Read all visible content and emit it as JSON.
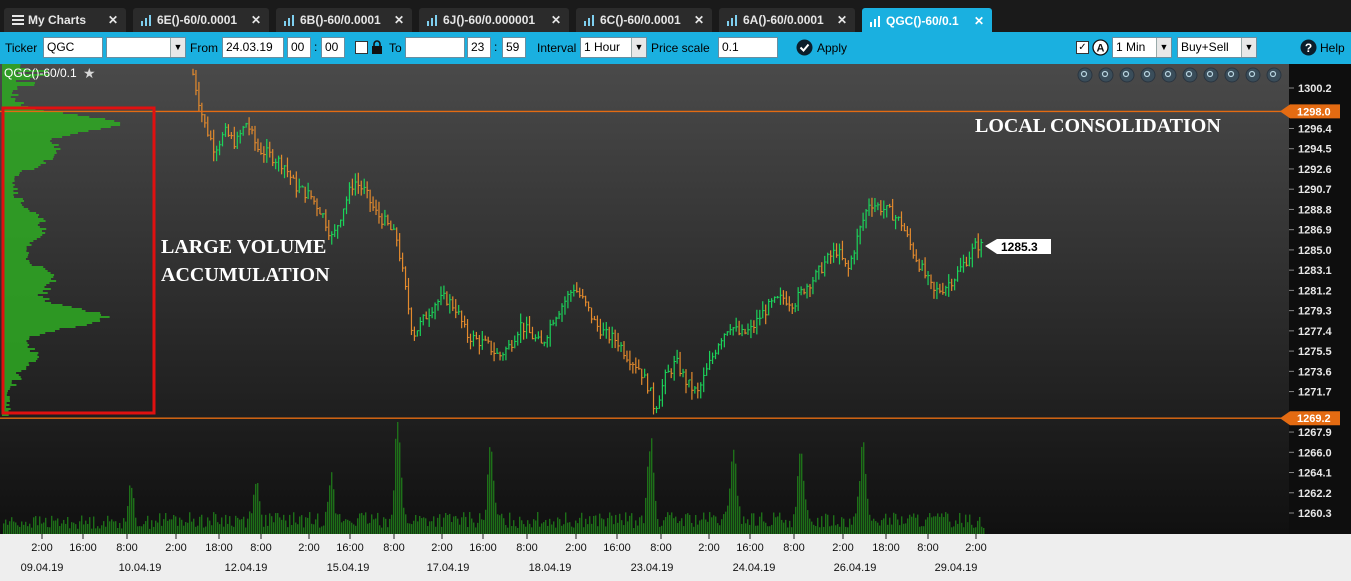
{
  "tabs": [
    {
      "label": "My Charts",
      "icon": "menu-icon",
      "active": false
    },
    {
      "label": "6E()-60/0.0001",
      "icon": "chart-icon",
      "active": false
    },
    {
      "label": "6B()-60/0.0001",
      "icon": "chart-icon",
      "active": false
    },
    {
      "label": "6J()-60/0.000001",
      "icon": "chart-icon",
      "active": false
    },
    {
      "label": "6C()-60/0.0001",
      "icon": "chart-icon",
      "active": false
    },
    {
      "label": "6A()-60/0.0001",
      "icon": "chart-icon",
      "active": false
    },
    {
      "label": "QGC()-60/0.1",
      "icon": "chart-icon",
      "active": true
    }
  ],
  "toolbar": {
    "ticker_label": "Ticker",
    "ticker_value": "QGC",
    "from_label": "From",
    "from_date": "24.03.19",
    "from_hour": "00",
    "from_min": "00",
    "to_label": "To",
    "to_date": "",
    "to_hour": "23",
    "to_min": "59",
    "interval_label": "Interval",
    "interval_value": "1 Hour",
    "price_scale_label": "Price scale",
    "price_scale_value": "0.1",
    "apply_label": "Apply",
    "aggregation_value": "1 Min",
    "side_value": "Buy+Sell",
    "help_label": "Help"
  },
  "chart": {
    "title": "QGC()-60/0.1",
    "last_price": "1285.3",
    "annotation_local": "LOCAL CONSOLIDATION",
    "annotation_large_1": "LARGE VOLUME",
    "annotation_large_2": "ACCUMULATION",
    "colors": {
      "background_top": "#474747",
      "background_bottom": "#121212",
      "up_bar": "#1bd35a",
      "down_bar": "#e38a2d",
      "level_line": "#e46b12",
      "volume_profile": "#2eaa22",
      "box": "#e01010",
      "volume": "#1f7a1a"
    }
  },
  "chart_data": {
    "type": "bar",
    "subtype": "ohlc_with_volume_profile",
    "title": "QGC()-60/0.1",
    "y_ticks": [
      1300.2,
      1298.0,
      1296.4,
      1294.5,
      1292.6,
      1290.7,
      1288.8,
      1286.9,
      1285.0,
      1283.1,
      1281.2,
      1279.3,
      1277.4,
      1275.5,
      1273.6,
      1271.7,
      1269.2,
      1267.9,
      1266.0,
      1264.1,
      1262.2,
      1260.3
    ],
    "ylim": [
      1259.0,
      1302.0
    ],
    "level_lines": [
      1298.0,
      1269.2
    ],
    "last_price": 1285.3,
    "x_time_labels": [
      "2:00",
      "16:00",
      "8:00",
      "2:00",
      "18:00",
      "8:00",
      "2:00",
      "16:00",
      "8:00",
      "2:00",
      "16:00",
      "8:00",
      "2:00",
      "16:00",
      "8:00",
      "2:00",
      "16:00",
      "8:00",
      "2:00",
      "18:00",
      "8:00",
      "2:00"
    ],
    "x_date_labels": [
      "09.04.19",
      "10.04.19",
      "12.04.19",
      "15.04.19",
      "17.04.19",
      "18.04.19",
      "23.04.19",
      "24.04.19",
      "26.04.19",
      "29.04.19"
    ],
    "price_path": [
      {
        "t": 0,
        "p": 1301.5
      },
      {
        "t": 2,
        "p": 1297.0
      },
      {
        "t": 4,
        "p": 1294.5
      },
      {
        "t": 6,
        "p": 1296.0
      },
      {
        "t": 8,
        "p": 1295.0
      },
      {
        "t": 10,
        "p": 1297.0
      },
      {
        "t": 12,
        "p": 1294.5
      },
      {
        "t": 14,
        "p": 1294.0
      },
      {
        "t": 17,
        "p": 1293.0
      },
      {
        "t": 19,
        "p": 1291.0
      },
      {
        "t": 22,
        "p": 1290.0
      },
      {
        "t": 24,
        "p": 1288.5
      },
      {
        "t": 26,
        "p": 1286.0
      },
      {
        "t": 28,
        "p": 1289.0
      },
      {
        "t": 30,
        "p": 1291.5
      },
      {
        "t": 32,
        "p": 1290.5
      },
      {
        "t": 34,
        "p": 1288.5
      },
      {
        "t": 36,
        "p": 1287.5
      },
      {
        "t": 38,
        "p": 1286.0
      },
      {
        "t": 40,
        "p": 1280.0
      },
      {
        "t": 41,
        "p": 1277.0
      },
      {
        "t": 43,
        "p": 1278.5
      },
      {
        "t": 45,
        "p": 1280.0
      },
      {
        "t": 47,
        "p": 1280.5
      },
      {
        "t": 49,
        "p": 1279.5
      },
      {
        "t": 51,
        "p": 1277.0
      },
      {
        "t": 53,
        "p": 1276.5
      },
      {
        "t": 55,
        "p": 1276.0
      },
      {
        "t": 57,
        "p": 1275.0
      },
      {
        "t": 59,
        "p": 1276.0
      },
      {
        "t": 61,
        "p": 1278.0
      },
      {
        "t": 63,
        "p": 1277.0
      },
      {
        "t": 65,
        "p": 1276.0
      },
      {
        "t": 67,
        "p": 1278.5
      },
      {
        "t": 69,
        "p": 1280.0
      },
      {
        "t": 71,
        "p": 1281.5
      },
      {
        "t": 73,
        "p": 1280.0
      },
      {
        "t": 75,
        "p": 1278.0
      },
      {
        "t": 77,
        "p": 1277.0
      },
      {
        "t": 79,
        "p": 1276.5
      },
      {
        "t": 81,
        "p": 1275.0
      },
      {
        "t": 83,
        "p": 1274.0
      },
      {
        "t": 85,
        "p": 1272.0
      },
      {
        "t": 86,
        "p": 1270.0
      },
      {
        "t": 88,
        "p": 1273.0
      },
      {
        "t": 90,
        "p": 1274.5
      },
      {
        "t": 92,
        "p": 1272.5
      },
      {
        "t": 94,
        "p": 1271.5
      },
      {
        "t": 96,
        "p": 1274.0
      },
      {
        "t": 98,
        "p": 1276.5
      },
      {
        "t": 100,
        "p": 1278.0
      },
      {
        "t": 102,
        "p": 1277.0
      },
      {
        "t": 104,
        "p": 1277.5
      },
      {
        "t": 106,
        "p": 1279.0
      },
      {
        "t": 108,
        "p": 1280.0
      },
      {
        "t": 110,
        "p": 1280.5
      },
      {
        "t": 112,
        "p": 1280.0
      },
      {
        "t": 114,
        "p": 1281.5
      },
      {
        "t": 116,
        "p": 1282.5
      },
      {
        "t": 118,
        "p": 1284.0
      },
      {
        "t": 120,
        "p": 1285.0
      },
      {
        "t": 122,
        "p": 1283.0
      },
      {
        "t": 124,
        "p": 1286.5
      },
      {
        "t": 126,
        "p": 1289.5
      },
      {
        "t": 128,
        "p": 1289.0
      },
      {
        "t": 130,
        "p": 1288.5
      },
      {
        "t": 132,
        "p": 1287.5
      },
      {
        "t": 134,
        "p": 1285.0
      },
      {
        "t": 136,
        "p": 1283.0
      },
      {
        "t": 138,
        "p": 1281.0
      },
      {
        "t": 140,
        "p": 1281.5
      },
      {
        "t": 142,
        "p": 1282.5
      },
      {
        "t": 144,
        "p": 1284.0
      },
      {
        "t": 146,
        "p": 1285.5
      },
      {
        "t": 147,
        "p": 1285.3
      }
    ]
  }
}
